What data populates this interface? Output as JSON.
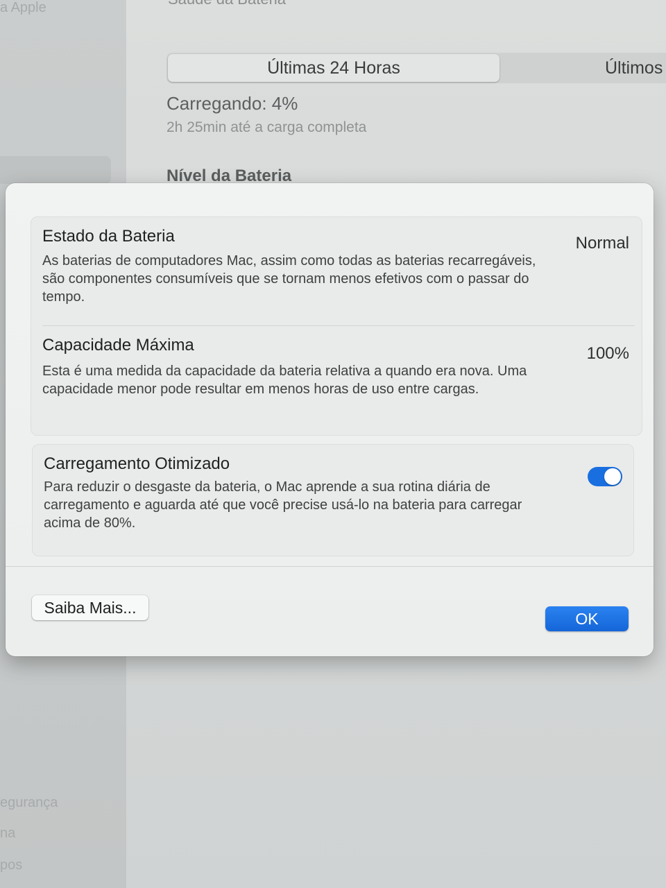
{
  "background": {
    "sidebar": {
      "top_item": "a Apple",
      "bottom_items": [
        "egurança",
        "na",
        "pos"
      ]
    },
    "title": "Saúde da Bateria",
    "segments": {
      "active": "Últimas 24 Horas",
      "other": "Últimos"
    },
    "charging_status": "Carregando: 4%",
    "charging_time": "2h 25min até a carga completa",
    "battery_level_heading": "Nível da Bateria"
  },
  "dialog": {
    "battery_condition": {
      "title": "Estado da Bateria",
      "value": "Normal",
      "description": "As baterias de computadores Mac, assim como todas as baterias recarregáveis, são componentes consumíveis que se tornam menos efetivos com o passar do tempo."
    },
    "maximum_capacity": {
      "title": "Capacidade Máxima",
      "value": "100%",
      "description": "Esta é uma medida da capacidade da bateria relativa a quando era nova. Uma capacidade menor pode resultar em menos horas de uso entre cargas."
    },
    "optimized_charging": {
      "title": "Carregamento Otimizado",
      "enabled": true,
      "description": "Para reduzir o desgaste da bateria, o Mac aprende a sua rotina diária de carregamento e aguarda até que você precise usá-lo na bateria para carregar acima de 80%."
    },
    "buttons": {
      "learn_more": "Saiba Mais...",
      "ok": "OK"
    }
  },
  "colors": {
    "accent": "#1a6fe0",
    "dialog_background": "#eceeed"
  }
}
